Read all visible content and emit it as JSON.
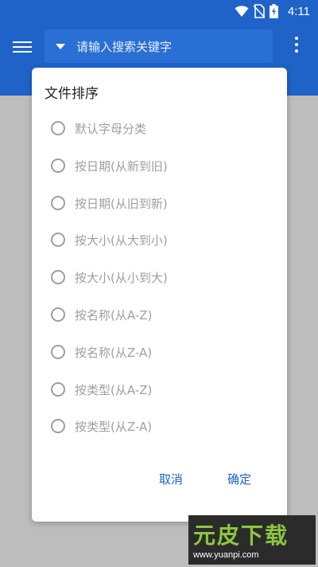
{
  "status_bar": {
    "time": "4:11",
    "icons": [
      "wifi-icon",
      "no-sim-icon",
      "battery-charging-icon"
    ]
  },
  "app_bar": {
    "color": "#1f63c9",
    "menu_icon": "hamburger-menu-icon",
    "search": {
      "placeholder": "请输入搜索关键字",
      "dropdown_icon": "caret-down-icon"
    },
    "more_icon": "more-vertical-icon"
  },
  "dialog": {
    "title": "文件排序",
    "options": [
      {
        "label": "默认字母分类",
        "selected": false
      },
      {
        "label": "按日期(从新到旧)",
        "selected": false
      },
      {
        "label": "按日期(从旧到新)",
        "selected": false
      },
      {
        "label": "按大小(从大到小)",
        "selected": false
      },
      {
        "label": "按大小(从小到大)",
        "selected": false
      },
      {
        "label": "按名称(从A-Z)",
        "selected": false
      },
      {
        "label": "按名称(从Z-A)",
        "selected": false
      },
      {
        "label": "按类型(从A-Z)",
        "selected": false
      },
      {
        "label": "按类型(从Z-A)",
        "selected": false
      }
    ],
    "cancel_label": "取消",
    "confirm_label": "确定"
  },
  "watermark": {
    "title": "元皮下载",
    "url": "www.yuanpi.com"
  }
}
